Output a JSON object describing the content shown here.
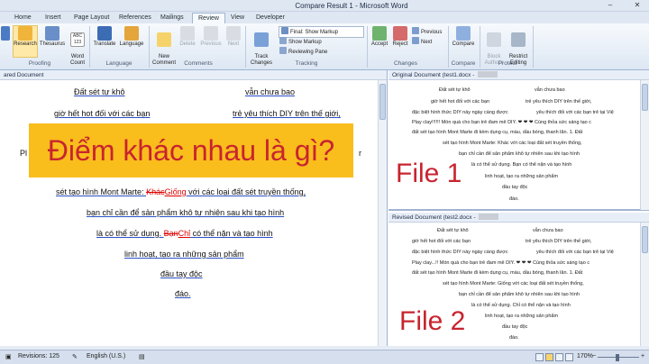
{
  "window": {
    "title": "Compare Result 1 - Microsoft Word",
    "minimize": "–",
    "close": "✕"
  },
  "tabs": [
    "Home",
    "Insert",
    "Page Layout",
    "References",
    "Mailings",
    "Review",
    "View",
    "Developer"
  ],
  "ribbon": {
    "proofing": {
      "label": "Proofing",
      "research": "Research",
      "thesaurus": "Thesaurus",
      "word_count": "Word\nCount",
      "word_count_icon": "ABC\n123"
    },
    "language": {
      "label": "Language",
      "translate": "Translate",
      "language": "Language"
    },
    "comments": {
      "label": "Comments",
      "new": "New\nComment",
      "delete": "Delete",
      "previous": "Previous",
      "next": "Next"
    },
    "tracking": {
      "label": "Tracking",
      "track_changes": "Track\nChanges",
      "final_show_markup": "Final: Show Markup",
      "show_markup": "Show Markup",
      "reviewing_pane": "Reviewing Pane"
    },
    "changes": {
      "label": "Changes",
      "accept": "Accept",
      "reject": "Reject",
      "previous": "Previous",
      "next": "Next"
    },
    "compare": {
      "label": "Compare",
      "compare": "Compare"
    },
    "protect": {
      "label": "Protect",
      "block_authors": "Block\nAuthors",
      "restrict_editing": "Restrict\nEditing"
    }
  },
  "left_pane": {
    "header": "ared Document",
    "line1_a": "Đất sét tự khô",
    "line1_b": "vẫn chưa bao",
    "line2_a": "giờ hết hot đối với các bạn",
    "line2_b": "trẻ yêu thích DIY trên thế giới,",
    "line3_prefix": "Pl",
    "line3_end": "r",
    "line4_a": "sét tạo hình Mont Marte: ",
    "line4_del": "Khác",
    "line4_ins": "Giống",
    "line4_b": " với các loại đất sét truyền thống,",
    "line5": "bạn chỉ cần để sản phẩm khô tự nhiên sau khi tạo hình",
    "line6_a": "là có thể sử dụng. ",
    "line6_del": "Bạn",
    "line6_ins": "Chỉ",
    "line6_b": " có thể nặn và tạo hình",
    "line7": "linh hoạt, tạo ra những sản phẩm",
    "line8": "đầu tay độc",
    "line9": "đáo."
  },
  "banner": {
    "text": "Điểm khác nhau là gì?"
  },
  "original_pane": {
    "header": "Original Document (test1.docx -",
    "lines": [
      "Đất sét tự khô",
      "vẫn chưa bao",
      "giờ hết hot đối với các bạn",
      "trẻ yêu thích DIY trên thế giới,",
      "đặc biệt hình thức DIY này ngày càng được",
      "yêu thích đối với các bạn trẻ tại Việ",
      "Play clay!!!!!! Món quà cho bạn trẻ đam mê DIY. ❤ ❤ ❤ Cùng thỏa sức sáng tạo c",
      "đất sét tạo hình Mont Marte đi kèm dụng cụ, màu, dầu bóng, thanh lăn. 1. Đất",
      "sét tạo hình Mont Marte: Khác với các loại đất sét truyền thống,",
      "bạn chỉ cần để sản phẩm khô tự nhiên sau khi tạo hình",
      "là có thể sử dụng. Bạn có thể nặn và tạo hình",
      "linh hoạt, tạo ra những sản phẩm",
      "đầu tay độc",
      "đáo."
    ],
    "file_label": "File 1"
  },
  "revised_pane": {
    "header": "Revised Document (test2.docx -",
    "lines": [
      "Đất sét tự khô",
      "vẫn chưa bao",
      "giờ hết hot đối với các bạn",
      "trẻ yêu thích DIY trên thế giới,",
      "đặc biệt hình thức DIY này ngày càng được",
      "yêu thích đối với các bạn trẻ tại Việ",
      "Play clay...!! Món quà cho bạn trẻ đam mê DIY. ❤ ❤ ❤ Cùng thỏa sức sáng tạo c",
      "đất sét tạo hình Mont Marte đi kèm dụng cụ, màu, dầu bóng, thanh lăn. 1. Đất",
      "sét tạo hình Mont Marte: Giống với các loại đất sét truyền thống,",
      "bạn chỉ cần để sản phẩm khô tự nhiên sau khi tạo hình",
      "là có thể sử dụng. Chỉ có thể nặn và tạo hình",
      "linh hoạt, tạo ra những sản phẩm",
      "đầu tay độc",
      "đáo."
    ],
    "file_label": "File 2"
  },
  "status": {
    "revisions": "Revisions: 125",
    "language": "English (U.S.)",
    "zoom": "170%"
  },
  "colors": {
    "banner_bg": "#f9bd1c",
    "banner_text": "#c8242f",
    "file_label": "#c8242f",
    "revision": "#dd0000"
  }
}
